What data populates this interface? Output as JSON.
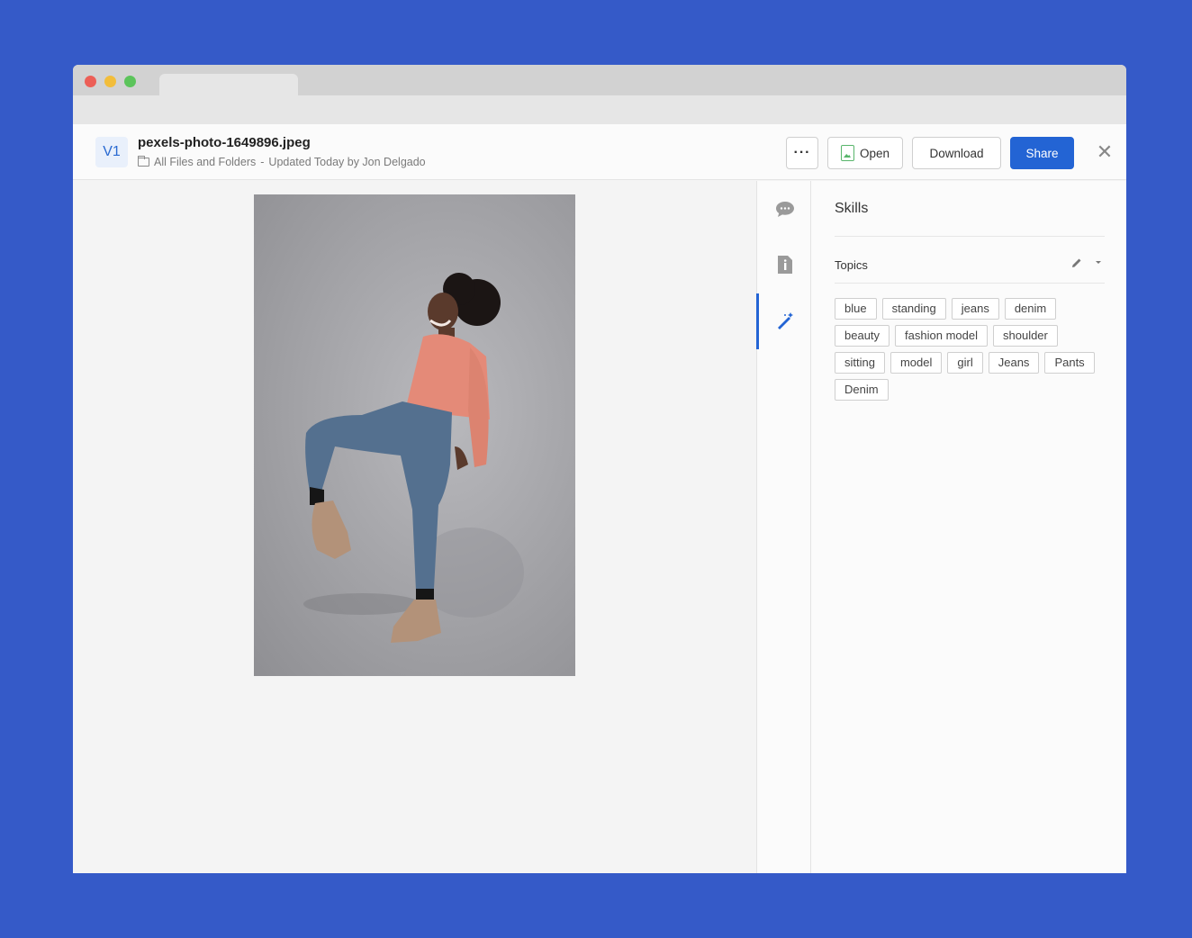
{
  "header": {
    "version": "V1",
    "filename": "pexels-photo-1649896.jpeg",
    "location": "All Files and Folders",
    "separator": "-",
    "updated": "Updated Today by Jon Delgado"
  },
  "toolbar": {
    "more_label": "···",
    "open_label": "Open",
    "download_label": "Download",
    "share_label": "Share",
    "close_label": "✕"
  },
  "sidebar": {
    "title": "Skills",
    "topics_label": "Topics",
    "tags": [
      "blue",
      "standing",
      "jeans",
      "denim",
      "beauty",
      "fashion model",
      "shoulder",
      "sitting",
      "model",
      "girl",
      "Jeans",
      "Pants",
      "Denim"
    ]
  },
  "rail": {
    "items": [
      "comment-icon",
      "info-icon",
      "magic-wand-icon"
    ],
    "active": "magic-wand-icon"
  },
  "colors": {
    "background": "#355ac8",
    "accent": "#2364d4"
  }
}
